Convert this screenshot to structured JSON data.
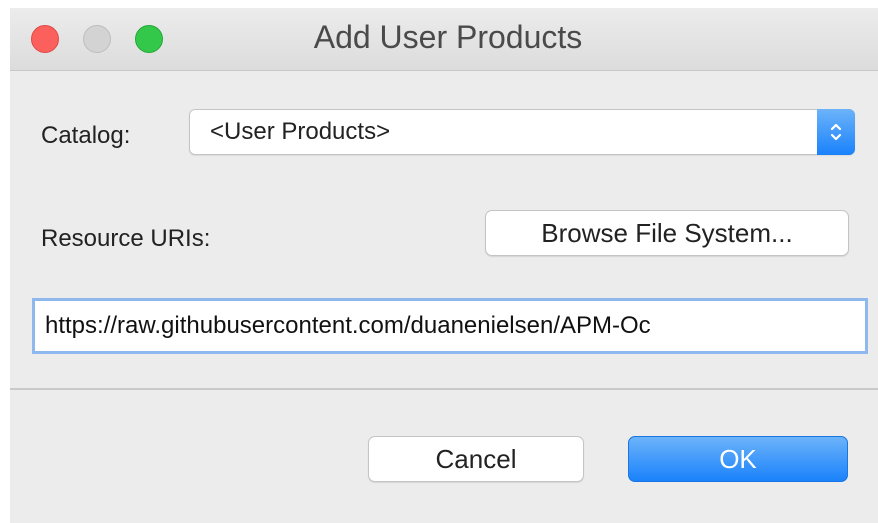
{
  "window": {
    "title": "Add User Products"
  },
  "form": {
    "catalog_label": "Catalog:",
    "catalog_value": "<User Products>",
    "resource_label": "Resource URIs:",
    "browse_label": "Browse File System...",
    "url_value": "https://raw.githubusercontent.com/duanenielsen/APM-Oc"
  },
  "footer": {
    "cancel_label": "Cancel",
    "ok_label": "OK"
  },
  "icons": {
    "close": "close-button-icon",
    "minimize": "minimize-button-icon",
    "zoom": "zoom-button-icon",
    "select_arrows": "up-down-chevron-icon"
  },
  "colors": {
    "accent": "#1a82fb",
    "close": "#fc605c",
    "zoom": "#34c84a",
    "focus_ring": "#8fb9ee"
  }
}
